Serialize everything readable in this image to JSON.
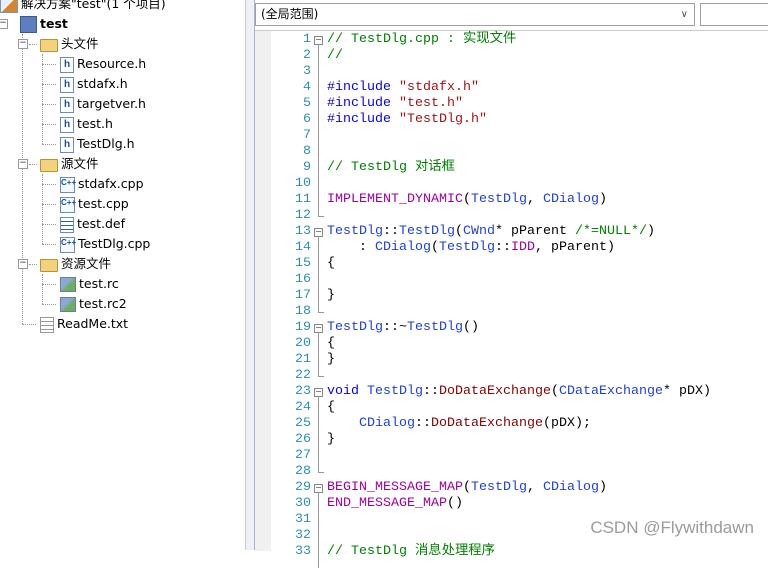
{
  "solution_explorer": {
    "solution": "解决方案\"test\"(1 个项目)",
    "project": "test",
    "folders": [
      {
        "label": "头文件",
        "files": [
          {
            "label": "Resource.h",
            "icon": "header-file-icon"
          },
          {
            "label": "stdafx.h",
            "icon": "header-file-icon"
          },
          {
            "label": "targetver.h",
            "icon": "header-file-icon"
          },
          {
            "label": "test.h",
            "icon": "header-file-icon"
          },
          {
            "label": "TestDlg.h",
            "icon": "header-file-icon"
          }
        ]
      },
      {
        "label": "源文件",
        "files": [
          {
            "label": "stdafx.cpp",
            "icon": "cpp-file-icon"
          },
          {
            "label": "test.cpp",
            "icon": "cpp-file-icon"
          },
          {
            "label": "test.def",
            "icon": "def-file-icon"
          },
          {
            "label": "TestDlg.cpp",
            "icon": "cpp-file-icon"
          }
        ]
      },
      {
        "label": "资源文件",
        "files": [
          {
            "label": "test.rc",
            "icon": "resource-file-icon"
          },
          {
            "label": "test.rc2",
            "icon": "resource-file-icon"
          }
        ]
      }
    ],
    "readme": "ReadMe.txt"
  },
  "editor": {
    "scope_dropdown": "(全局范围)",
    "member_dropdown": "",
    "colors": {
      "comment": "#008000",
      "keyword": "#0000ff",
      "string": "#a31515",
      "macro": "#a000a0",
      "type": "#1f3fdf",
      "function": "#880000",
      "line_number": "#2b91af"
    },
    "lines": [
      [
        [
          "c",
          "// TestDlg.cpp : 实现文件"
        ]
      ],
      [
        [
          "c",
          "//"
        ]
      ],
      [],
      [
        [
          "k",
          "#include "
        ],
        [
          "s",
          "\"stdafx.h\""
        ]
      ],
      [
        [
          "k",
          "#include "
        ],
        [
          "s",
          "\"test.h\""
        ]
      ],
      [
        [
          "k",
          "#include "
        ],
        [
          "s",
          "\"TestDlg.h\""
        ]
      ],
      [],
      [],
      [
        [
          "c",
          "// TestDlg 对话框"
        ]
      ],
      [],
      [
        [
          "m",
          "IMPLEMENT_DYNAMIC"
        ],
        [
          "",
          "("
        ],
        [
          "t",
          "TestDlg"
        ],
        [
          "",
          ", "
        ],
        [
          "t",
          "CDialog"
        ],
        [
          "",
          ")"
        ]
      ],
      [],
      [
        [
          "t",
          "TestDlg"
        ],
        [
          "",
          "::"
        ],
        [
          "t",
          "TestDlg"
        ],
        [
          "",
          "("
        ],
        [
          "t",
          "CWnd"
        ],
        [
          "",
          "* pParent "
        ],
        [
          "c",
          "/*=NULL*/"
        ],
        [
          "",
          ")"
        ]
      ],
      [
        [
          "",
          "    : "
        ],
        [
          "t",
          "CDialog"
        ],
        [
          "",
          "("
        ],
        [
          "t",
          "TestDlg"
        ],
        [
          "",
          "::"
        ],
        [
          "m",
          "IDD"
        ],
        [
          "",
          ", pParent)"
        ]
      ],
      [
        [
          "",
          "{"
        ]
      ],
      [],
      [
        [
          "",
          "}"
        ]
      ],
      [],
      [
        [
          "t",
          "TestDlg"
        ],
        [
          "",
          "::~"
        ],
        [
          "t",
          "TestDlg"
        ],
        [
          "",
          "()"
        ]
      ],
      [
        [
          "",
          "{"
        ]
      ],
      [
        [
          "",
          "}"
        ]
      ],
      [],
      [
        [
          "k",
          "void "
        ],
        [
          "t",
          "TestDlg"
        ],
        [
          "",
          "::"
        ],
        [
          "f",
          "DoDataExchange"
        ],
        [
          "",
          "("
        ],
        [
          "t",
          "CDataExchange"
        ],
        [
          "",
          "* pDX)"
        ]
      ],
      [
        [
          "",
          "{"
        ]
      ],
      [
        [
          "",
          "    "
        ],
        [
          "t",
          "CDialog"
        ],
        [
          "",
          "::"
        ],
        [
          "f",
          "DoDataExchange"
        ],
        [
          "",
          "(pDX);"
        ]
      ],
      [
        [
          "",
          "}"
        ]
      ],
      [],
      [],
      [
        [
          "m",
          "BEGIN_MESSAGE_MAP"
        ],
        [
          "",
          "("
        ],
        [
          "t",
          "TestDlg"
        ],
        [
          "",
          ", "
        ],
        [
          "t",
          "CDialog"
        ],
        [
          "",
          ")"
        ]
      ],
      [
        [
          "m",
          "END_MESSAGE_MAP"
        ],
        [
          "",
          "()"
        ]
      ],
      [],
      [],
      [
        [
          "c",
          "// TestDlg 消息处理程序"
        ]
      ]
    ],
    "fold_starts": [
      1,
      13,
      19,
      23,
      29
    ],
    "fold_ends": [
      12,
      18,
      22,
      28
    ]
  },
  "watermark": "CSDN @Flywithdawn"
}
